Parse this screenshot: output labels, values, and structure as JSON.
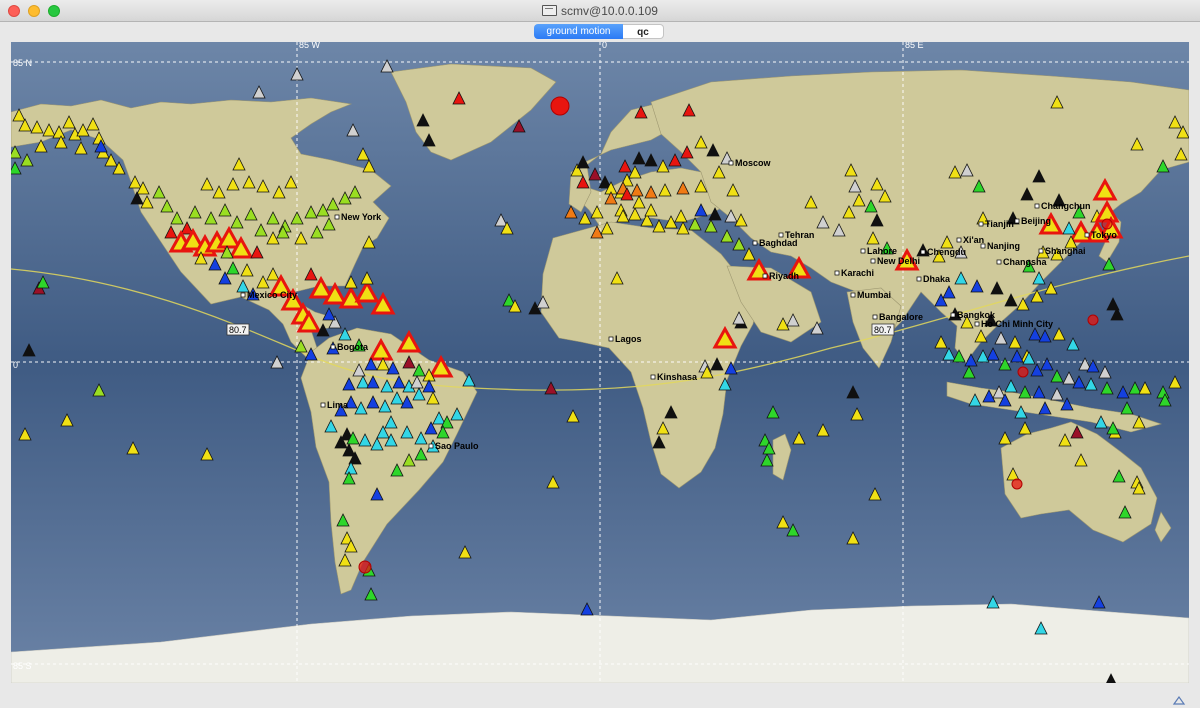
{
  "window": {
    "title": "scmv@10.0.0.109"
  },
  "tabs": [
    {
      "label": "ground motion",
      "active": true
    },
    {
      "label": "qc",
      "active": false
    }
  ],
  "map": {
    "grid_labels": {
      "lon_west": "85 W",
      "lon_zero": "0",
      "lon_east": "85 E",
      "lat_north": "85 N",
      "lat_zero": "0",
      "lat_south": "85 S"
    },
    "orbit_labels": [
      "80.7",
      "80.7"
    ],
    "cities": [
      "Moscow",
      "New York",
      "Tehran",
      "Baghdad",
      "Riyadh",
      "Karachi",
      "Lahore",
      "New Delhi",
      "Chengdu",
      "Xi'an",
      "Tianjin",
      "Beijing",
      "Changchun",
      "Tokyo",
      "Nanjing",
      "Shanghai",
      "Changsha",
      "Dhaka",
      "Mumbai",
      "Bangalore",
      "Bangkok",
      "Ho Chi Minh City",
      "Mexico City",
      "Bogota",
      "Lagos",
      "Kinshasa",
      "Lima",
      "Sao Paulo"
    ],
    "colors": {
      "ocean": "#445f86",
      "land": "#cfc99a",
      "ice": "#eeeee7",
      "red": "#e8150f",
      "orange": "#f07a14",
      "yellow": "#f0e014",
      "lime": "#9ade22",
      "green": "#2ed62a",
      "cyan": "#33d6e6",
      "blue": "#1440e0",
      "black": "#101010",
      "darkred": "#9a1028",
      "gray": "#d0d0d0"
    }
  }
}
